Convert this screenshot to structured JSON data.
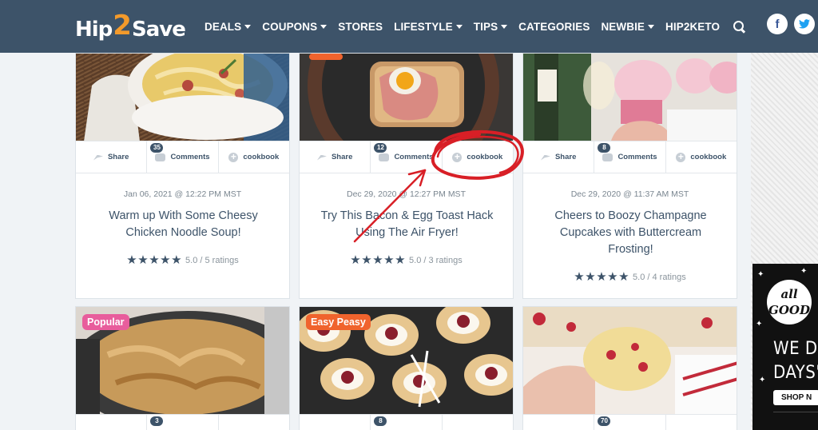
{
  "header": {
    "logo": {
      "part1": "Hip",
      "part2": "2",
      "part3": "Save"
    },
    "nav": [
      {
        "label": "DEALS",
        "caret": true
      },
      {
        "label": "COUPONS",
        "caret": true
      },
      {
        "label": "STORES",
        "caret": false
      },
      {
        "label": "LIFESTYLE",
        "caret": true
      },
      {
        "label": "TIPS",
        "caret": true
      },
      {
        "label": "CATEGORIES",
        "caret": false
      },
      {
        "label": "NEWBIE",
        "caret": true
      },
      {
        "label": "HIP2KETO",
        "caret": false
      }
    ],
    "social": {
      "facebook": "f",
      "twitter": "t"
    }
  },
  "actions": {
    "share": "Share",
    "comments": "Comments",
    "cookbook": "cookbook"
  },
  "cards": [
    {
      "comments": "35",
      "date": "Jan 06, 2021 @ 12:22 PM MST",
      "title": "Warm up With Some Cheesy Chicken Noodle Soup!",
      "stars": "★★★★★",
      "rating": "5.0 / 5 ratings"
    },
    {
      "comments": "12",
      "date": "Dec 29, 2020 @ 12:27 PM MST",
      "title": "Try This Bacon & Egg Toast Hack Using The Air Fryer!",
      "stars": "★★★★★",
      "rating": "5.0 / 3 ratings"
    },
    {
      "comments": "8",
      "date": "Dec 29, 2020 @ 11:37 AM MST",
      "title": "Cheers to Boozy Champagne Cupcakes with Buttercream Frosting!",
      "stars": "★★★★★",
      "rating": "5.0 / 4 ratings"
    }
  ],
  "bottom_cards": [
    {
      "badge": "Popular",
      "comments": "3"
    },
    {
      "badge": "Easy Peasy",
      "comments": "8"
    },
    {
      "badge": "",
      "comments": "70"
    }
  ],
  "ad": {
    "logo_line1": "all",
    "logo_line2": "GOOD",
    "headline_1": "WE DO",
    "headline_2": "DAYS' W",
    "button": "SHOP N"
  },
  "colors": {
    "navy": "#3d5369",
    "badge_popular": "#e85d9c",
    "badge_easy": "#f0632d",
    "annotation": "#d81f26"
  }
}
